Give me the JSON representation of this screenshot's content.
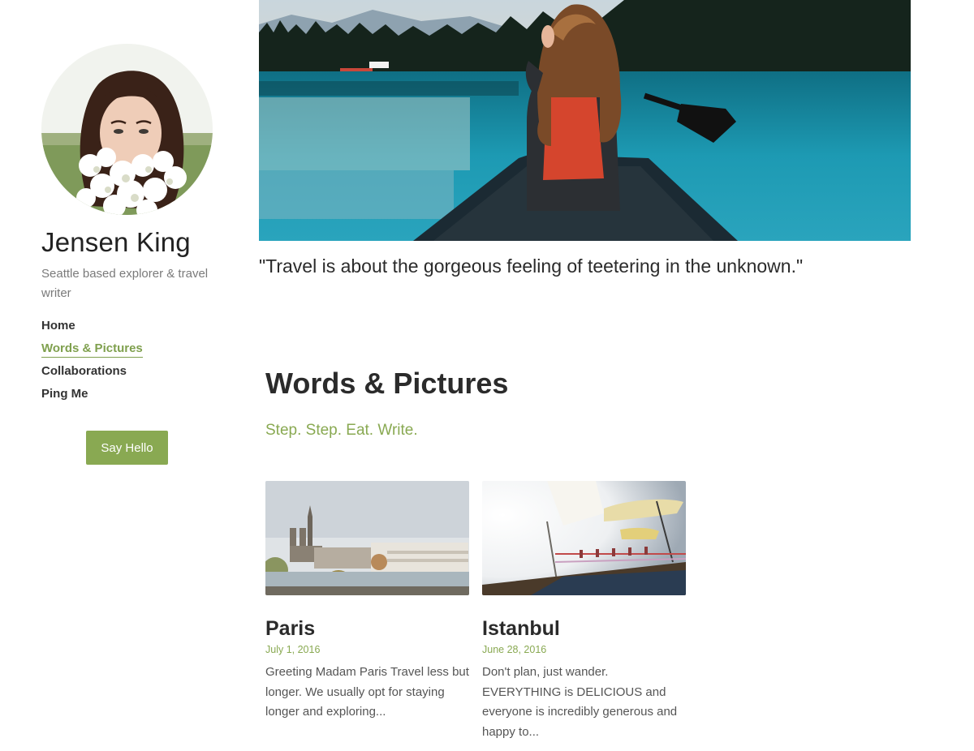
{
  "profile": {
    "name": "Jensen King",
    "bio": "Seattle based explorer & travel writer"
  },
  "nav": {
    "items": [
      {
        "label": "Home",
        "active": false
      },
      {
        "label": "Words & Pictures",
        "active": true
      },
      {
        "label": "Collaborations",
        "active": false
      },
      {
        "label": "Ping Me",
        "active": false
      }
    ]
  },
  "cta": {
    "label": "Say Hello"
  },
  "hero": {
    "quote": "\"Travel is about the gorgeous feeling of teetering in the unknown.\""
  },
  "section": {
    "title": "Words & Pictures",
    "subtitle": "Step. Step. Eat. Write."
  },
  "posts": [
    {
      "title": "Paris",
      "date": "July 1, 2016",
      "excerpt": "Greeting Madam Paris Travel less but longer. We usually opt for staying longer and exploring..."
    },
    {
      "title": "Istanbul",
      "date": "June 28, 2016",
      "excerpt": "Don't plan, just wander. EVERYTHING is DELICIOUS and everyone is incredibly generous and happy to..."
    }
  ],
  "colors": {
    "accent": "#89a952",
    "text": "#333333",
    "muted": "#7a7a7a"
  }
}
